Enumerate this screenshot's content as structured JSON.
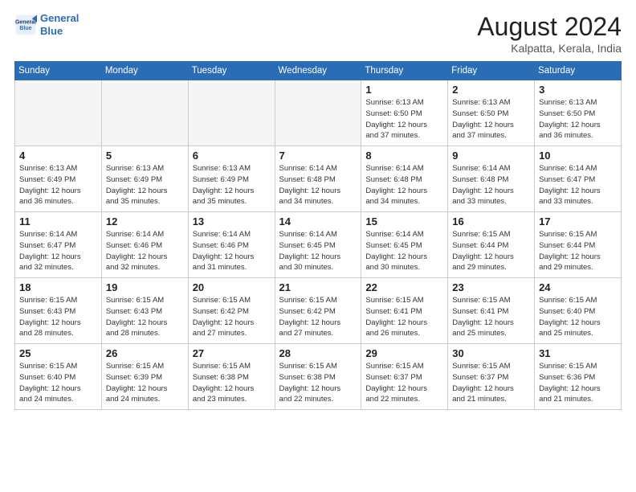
{
  "header": {
    "logo_line1": "General",
    "logo_line2": "Blue",
    "month_title": "August 2024",
    "location": "Kalpatta, Kerala, India"
  },
  "weekdays": [
    "Sunday",
    "Monday",
    "Tuesday",
    "Wednesday",
    "Thursday",
    "Friday",
    "Saturday"
  ],
  "weeks": [
    [
      {
        "day": "",
        "info": ""
      },
      {
        "day": "",
        "info": ""
      },
      {
        "day": "",
        "info": ""
      },
      {
        "day": "",
        "info": ""
      },
      {
        "day": "1",
        "info": "Sunrise: 6:13 AM\nSunset: 6:50 PM\nDaylight: 12 hours\nand 37 minutes."
      },
      {
        "day": "2",
        "info": "Sunrise: 6:13 AM\nSunset: 6:50 PM\nDaylight: 12 hours\nand 37 minutes."
      },
      {
        "day": "3",
        "info": "Sunrise: 6:13 AM\nSunset: 6:50 PM\nDaylight: 12 hours\nand 36 minutes."
      }
    ],
    [
      {
        "day": "4",
        "info": "Sunrise: 6:13 AM\nSunset: 6:49 PM\nDaylight: 12 hours\nand 36 minutes."
      },
      {
        "day": "5",
        "info": "Sunrise: 6:13 AM\nSunset: 6:49 PM\nDaylight: 12 hours\nand 35 minutes."
      },
      {
        "day": "6",
        "info": "Sunrise: 6:13 AM\nSunset: 6:49 PM\nDaylight: 12 hours\nand 35 minutes."
      },
      {
        "day": "7",
        "info": "Sunrise: 6:14 AM\nSunset: 6:48 PM\nDaylight: 12 hours\nand 34 minutes."
      },
      {
        "day": "8",
        "info": "Sunrise: 6:14 AM\nSunset: 6:48 PM\nDaylight: 12 hours\nand 34 minutes."
      },
      {
        "day": "9",
        "info": "Sunrise: 6:14 AM\nSunset: 6:48 PM\nDaylight: 12 hours\nand 33 minutes."
      },
      {
        "day": "10",
        "info": "Sunrise: 6:14 AM\nSunset: 6:47 PM\nDaylight: 12 hours\nand 33 minutes."
      }
    ],
    [
      {
        "day": "11",
        "info": "Sunrise: 6:14 AM\nSunset: 6:47 PM\nDaylight: 12 hours\nand 32 minutes."
      },
      {
        "day": "12",
        "info": "Sunrise: 6:14 AM\nSunset: 6:46 PM\nDaylight: 12 hours\nand 32 minutes."
      },
      {
        "day": "13",
        "info": "Sunrise: 6:14 AM\nSunset: 6:46 PM\nDaylight: 12 hours\nand 31 minutes."
      },
      {
        "day": "14",
        "info": "Sunrise: 6:14 AM\nSunset: 6:45 PM\nDaylight: 12 hours\nand 30 minutes."
      },
      {
        "day": "15",
        "info": "Sunrise: 6:14 AM\nSunset: 6:45 PM\nDaylight: 12 hours\nand 30 minutes."
      },
      {
        "day": "16",
        "info": "Sunrise: 6:15 AM\nSunset: 6:44 PM\nDaylight: 12 hours\nand 29 minutes."
      },
      {
        "day": "17",
        "info": "Sunrise: 6:15 AM\nSunset: 6:44 PM\nDaylight: 12 hours\nand 29 minutes."
      }
    ],
    [
      {
        "day": "18",
        "info": "Sunrise: 6:15 AM\nSunset: 6:43 PM\nDaylight: 12 hours\nand 28 minutes."
      },
      {
        "day": "19",
        "info": "Sunrise: 6:15 AM\nSunset: 6:43 PM\nDaylight: 12 hours\nand 28 minutes."
      },
      {
        "day": "20",
        "info": "Sunrise: 6:15 AM\nSunset: 6:42 PM\nDaylight: 12 hours\nand 27 minutes."
      },
      {
        "day": "21",
        "info": "Sunrise: 6:15 AM\nSunset: 6:42 PM\nDaylight: 12 hours\nand 27 minutes."
      },
      {
        "day": "22",
        "info": "Sunrise: 6:15 AM\nSunset: 6:41 PM\nDaylight: 12 hours\nand 26 minutes."
      },
      {
        "day": "23",
        "info": "Sunrise: 6:15 AM\nSunset: 6:41 PM\nDaylight: 12 hours\nand 25 minutes."
      },
      {
        "day": "24",
        "info": "Sunrise: 6:15 AM\nSunset: 6:40 PM\nDaylight: 12 hours\nand 25 minutes."
      }
    ],
    [
      {
        "day": "25",
        "info": "Sunrise: 6:15 AM\nSunset: 6:40 PM\nDaylight: 12 hours\nand 24 minutes."
      },
      {
        "day": "26",
        "info": "Sunrise: 6:15 AM\nSunset: 6:39 PM\nDaylight: 12 hours\nand 24 minutes."
      },
      {
        "day": "27",
        "info": "Sunrise: 6:15 AM\nSunset: 6:38 PM\nDaylight: 12 hours\nand 23 minutes."
      },
      {
        "day": "28",
        "info": "Sunrise: 6:15 AM\nSunset: 6:38 PM\nDaylight: 12 hours\nand 22 minutes."
      },
      {
        "day": "29",
        "info": "Sunrise: 6:15 AM\nSunset: 6:37 PM\nDaylight: 12 hours\nand 22 minutes."
      },
      {
        "day": "30",
        "info": "Sunrise: 6:15 AM\nSunset: 6:37 PM\nDaylight: 12 hours\nand 21 minutes."
      },
      {
        "day": "31",
        "info": "Sunrise: 6:15 AM\nSunset: 6:36 PM\nDaylight: 12 hours\nand 21 minutes."
      }
    ]
  ]
}
